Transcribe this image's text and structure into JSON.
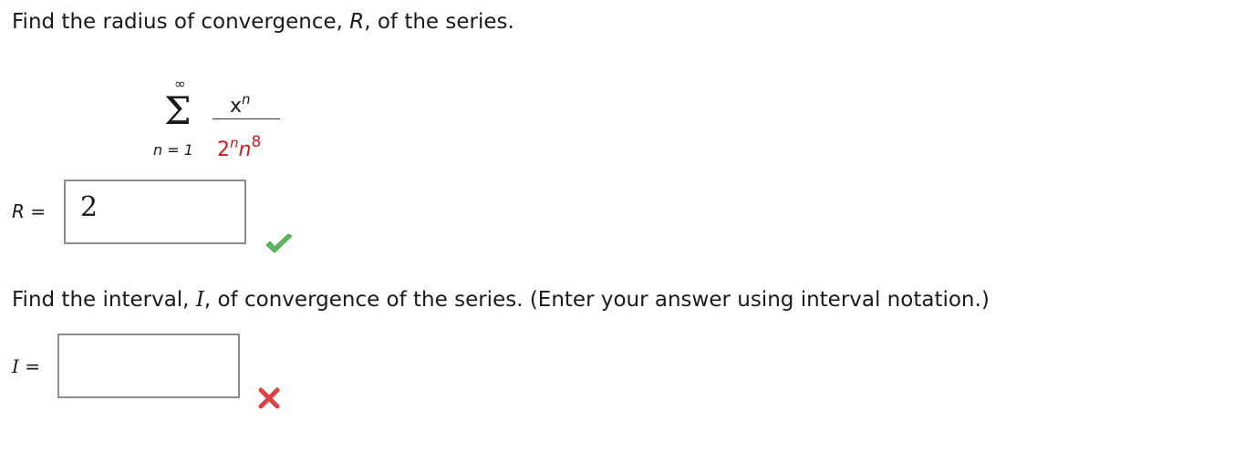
{
  "question1": {
    "prefix": "Find the radius of convergence, ",
    "var": "R",
    "suffix": ", of the series."
  },
  "series": {
    "upper_limit": "∞",
    "sigma": "Σ",
    "lower_limit": "n = 1",
    "numerator_base": "x",
    "numerator_exp": "n",
    "denominator_base": "2",
    "denominator_exp": "n",
    "denominator_var": "n",
    "denominator_var_exp": "8"
  },
  "answer_r": {
    "label_var": "R",
    "label_eq": "=",
    "value": "2",
    "status": "correct",
    "status_color": "#5cb85c"
  },
  "question2": {
    "prefix": "Find the interval, ",
    "var": "I",
    "suffix": ", of convergence of the series. (Enter your answer using interval notation.)"
  },
  "answer_i": {
    "label_var": "I",
    "label_eq": "=",
    "value": "",
    "status": "incorrect",
    "status_color": "#e04040"
  },
  "colors": {
    "text": "#1a1a1a",
    "highlight_red": "#d11a1a",
    "box_border": "#8c8c8c"
  }
}
